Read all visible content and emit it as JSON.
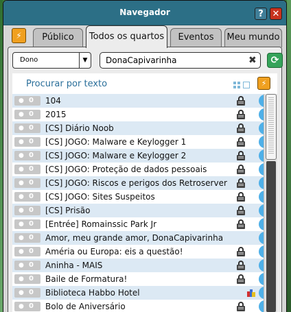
{
  "window": {
    "title": "Navegador",
    "help_label": "?",
    "close_label": "✕"
  },
  "tabs": [
    {
      "label": "Público",
      "active": false
    },
    {
      "label": "Todos os quartos",
      "active": true
    },
    {
      "label": "Eventos",
      "active": false
    },
    {
      "label": "Meu mundo",
      "active": false
    }
  ],
  "filter": {
    "selected": "Dono",
    "arrow": "▼"
  },
  "search": {
    "value": "DonaCapivarinha"
  },
  "list": {
    "section_title": "Procurar por texto",
    "rows": [
      {
        "users": "0",
        "name": "104",
        "locked": true,
        "info": "i"
      },
      {
        "users": "0",
        "name": "2015",
        "locked": true,
        "info": "i"
      },
      {
        "users": "0",
        "name": "[CS] Diário Noob",
        "locked": true,
        "info": "i"
      },
      {
        "users": "0",
        "name": "[CS] JOGO: Malware e Keylogger 1",
        "locked": true,
        "info": "i"
      },
      {
        "users": "0",
        "name": "[CS] JOGO: Malware e Keylogger 2",
        "locked": true,
        "info": "i"
      },
      {
        "users": "0",
        "name": "[CS] JOGO: Proteção de dados pessoais",
        "locked": true,
        "info": "i"
      },
      {
        "users": "0",
        "name": "[CS] JOGO: Riscos e perigos dos Retroserver",
        "locked": true,
        "info": "i"
      },
      {
        "users": "0",
        "name": "[CS] JOGO: Sites Suspeitos",
        "locked": true,
        "info": "i"
      },
      {
        "users": "0",
        "name": "[CS] Prisão",
        "locked": true,
        "info": "i"
      },
      {
        "users": "0",
        "name": "[Entrée] Romainssic Park Jr",
        "locked": true,
        "info": "i"
      },
      {
        "users": "0",
        "name": "Amor, meu grande amor, DonaCapivarinha",
        "locked": false,
        "info": "i"
      },
      {
        "users": "0",
        "name": "Améria ou Europa: eis a questão!",
        "locked": true,
        "info": "i"
      },
      {
        "users": "0",
        "name": "Aninha - MAIS",
        "locked": true,
        "info": "i"
      },
      {
        "users": "0",
        "name": "Baile de Formatura!",
        "locked": true,
        "info": "i"
      },
      {
        "users": "0",
        "name": "Biblioteca Habbo Hotel",
        "locked": false,
        "party": true,
        "info": "i"
      },
      {
        "users": "0",
        "name": "Bolo de Aniversário",
        "locked": true,
        "info": "i"
      }
    ]
  },
  "colors": {
    "titlebar": "#2c6f86",
    "row_alt": "#dce9f4",
    "info_icon": "#4fb0e8",
    "refresh": "#35a35a",
    "bolt": "#f0a020"
  },
  "icons": {
    "bolt": "⚡",
    "refresh": "⟳",
    "clear": "✖",
    "person": "👤"
  }
}
